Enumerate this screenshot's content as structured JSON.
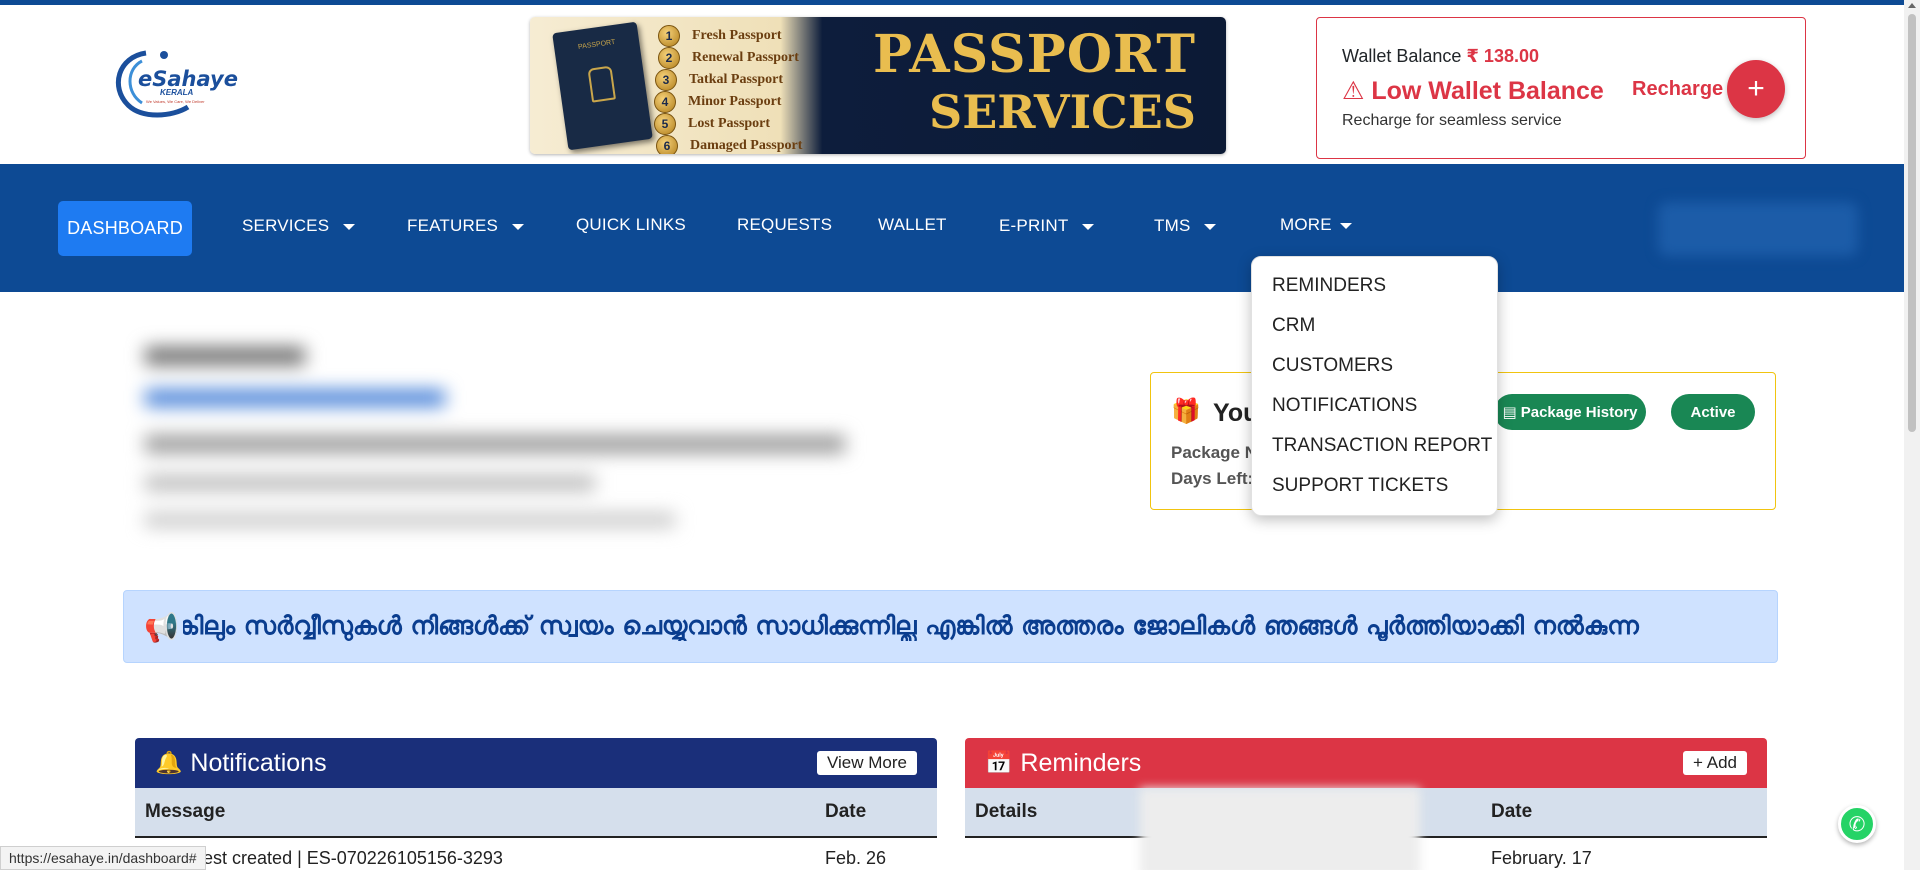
{
  "logo": {
    "brand": "eSahaye",
    "sub": "KERALA",
    "tagline": "We Values, We Care, We Deliver"
  },
  "banner": {
    "items": [
      {
        "num": "1",
        "label": "Fresh Passport"
      },
      {
        "num": "2",
        "label": "Renewal Passport"
      },
      {
        "num": "3",
        "label": "Tatkal Passport"
      },
      {
        "num": "4",
        "label": "Minor Passport"
      },
      {
        "num": "5",
        "label": "Lost Passport"
      },
      {
        "num": "6",
        "label": "Damaged Passport"
      }
    ],
    "title_line1": "PASSPORT",
    "title_line2": "SERVICES",
    "book_label": "PASSPORT"
  },
  "wallet": {
    "balance_label": "Wallet Balance",
    "balance_value": "₹ 138.00",
    "warning": "Low Wallet Balance",
    "hint": "Recharge for seamless service",
    "recharge_label": "Recharge",
    "plus": "+"
  },
  "nav": {
    "dashboard": "DASHBOARD",
    "services": "SERVICES",
    "features": "FEATURES",
    "quick_links": "QUICK LINKS",
    "requests": "REQUESTS",
    "wallet": "WALLET",
    "eprint": "E-PRINT",
    "tms": "TMS",
    "more": "MORE"
  },
  "more_menu": [
    "REMINDERS",
    "CRM",
    "CUSTOMERS",
    "NOTIFICATIONS",
    "TRANSACTION REPORT",
    "SUPPORT TICKETS"
  ],
  "package": {
    "title": "You",
    "package_label": "Package N",
    "days_label": "Days Left:",
    "history_button": "Package History",
    "status": "Active"
  },
  "marquee": {
    "text": "ങ്കിലും സർവ്വീസുകൾ നിങ്ങൾക്ക് സ്വയം ചെയ്യുവാൻ സാധിക്കുന്നില്ല എങ്കിൽ അത്തരം ജോലികൾ ഞങ്ങൾ പൂർത്തിയാക്കി നൽകുന്ന"
  },
  "notifications": {
    "title": "Notifications",
    "view_more": "View More",
    "col_message": "Message",
    "col_date": "Date",
    "rows": [
      {
        "message": "equest created | ES-070226105156-3293",
        "date": "Feb. 26"
      }
    ]
  },
  "reminders": {
    "title": "Reminders",
    "add": "+ Add",
    "col_details": "Details",
    "col_date": "Date",
    "rows": [
      {
        "date": "February. 17"
      }
    ]
  },
  "status_url": "https://esahaye.in/dashboard#",
  "colors": {
    "nav": "#0d4a94",
    "accent": "#1e7bf2",
    "danger": "#dc3545",
    "success": "#198754",
    "notify_head": "#1a2f7a"
  }
}
